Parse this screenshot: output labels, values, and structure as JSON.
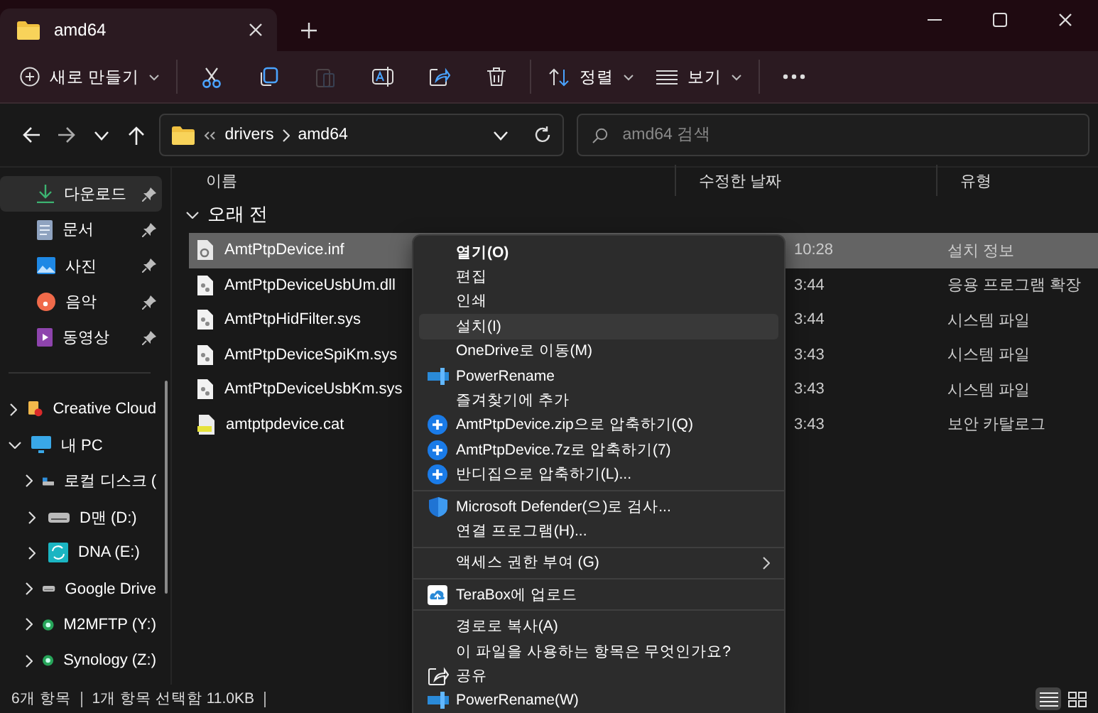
{
  "window": {
    "tab_title": "amd64"
  },
  "toolbar": {
    "items": [
      {
        "kind": "new",
        "label": "새로 만들기",
        "disabled": false
      },
      {
        "kind": "cut",
        "disabled": false
      },
      {
        "kind": "copy",
        "disabled": false
      },
      {
        "kind": "paste",
        "disabled": true
      },
      {
        "kind": "rename",
        "disabled": false
      },
      {
        "kind": "share",
        "disabled": false
      },
      {
        "kind": "delete",
        "disabled": false
      },
      {
        "kind": "sort",
        "label": "정렬",
        "disabled": false
      },
      {
        "kind": "view",
        "label": "보기",
        "disabled": false
      },
      {
        "kind": "more",
        "disabled": false
      }
    ]
  },
  "address": {
    "path": [
      "drivers",
      "amd64"
    ],
    "search_placeholder": "amd64 검색"
  },
  "sidebar": {
    "quick_access": [
      {
        "label": "다운로드",
        "kind": "download",
        "selected": true
      },
      {
        "label": "문서",
        "kind": "document",
        "selected": false
      },
      {
        "label": "사진",
        "kind": "picture",
        "selected": false
      },
      {
        "label": "음악",
        "kind": "music",
        "selected": false
      },
      {
        "label": "동영상",
        "kind": "video",
        "selected": false
      }
    ],
    "tree": [
      {
        "label": "Creative Cloud",
        "kind": "cloud",
        "expanded": false,
        "selected": false
      },
      {
        "label": "내 PC",
        "kind": "pc",
        "expanded": true,
        "selected": false,
        "children": [
          {
            "label": "로컬 디스크 (",
            "kind": "system-drive",
            "expanded": false,
            "selected": false
          },
          {
            "label": "D맨 (D:)",
            "kind": "drive",
            "expanded": false,
            "selected": false
          },
          {
            "label": "DNA (E:)",
            "kind": "sync-drive",
            "expanded": false,
            "selected": false
          },
          {
            "label": "Google Drive",
            "kind": "drive",
            "expanded": false,
            "selected": false
          },
          {
            "label": "M2MFTP (Y:)",
            "kind": "network-drive",
            "expanded": false,
            "selected": false
          },
          {
            "label": "Synology (Z:)",
            "kind": "network-drive",
            "expanded": false,
            "selected": false
          }
        ]
      }
    ]
  },
  "file_list": {
    "columns": [
      "이름",
      "수정한 날짜",
      "유형"
    ],
    "group": "오래 전",
    "rows": [
      {
        "name": "AmtPtpDevice.inf",
        "modified": "10:28",
        "type": "설치 정보",
        "kind": "setup",
        "selected": true
      },
      {
        "name": "AmtPtpDeviceUsbUm.dll",
        "modified": "3:44",
        "type": "응용 프로그램 확장",
        "kind": "system",
        "selected": false
      },
      {
        "name": "AmtPtpHidFilter.sys",
        "modified": "3:44",
        "type": "시스템 파일",
        "kind": "system",
        "selected": false
      },
      {
        "name": "AmtPtpDeviceSpiKm.sys",
        "modified": "3:43",
        "type": "시스템 파일",
        "kind": "system",
        "selected": false
      },
      {
        "name": "AmtPtpDeviceUsbKm.sys",
        "modified": "3:43",
        "type": "시스템 파일",
        "kind": "system",
        "selected": false
      },
      {
        "name": "amtptpdevice.cat",
        "modified": "3:43",
        "type": "보안 카탈로그",
        "kind": "catalog",
        "selected": false
      }
    ]
  },
  "context_menu": {
    "items": [
      {
        "kind": "item",
        "label": "열기(O)",
        "default": true,
        "selected": false,
        "submenu": false
      },
      {
        "kind": "item",
        "label": "편집",
        "default": false,
        "selected": false,
        "submenu": false
      },
      {
        "kind": "item",
        "label": "인쇄",
        "default": false,
        "selected": false,
        "submenu": false
      },
      {
        "kind": "item",
        "label": "설치(I)",
        "default": false,
        "selected": true,
        "submenu": false
      },
      {
        "kind": "item",
        "label": "OneDrive로 이동(M)",
        "default": false,
        "selected": false,
        "submenu": false
      },
      {
        "kind": "rename",
        "label": "PowerRename",
        "default": false,
        "selected": false,
        "submenu": false
      },
      {
        "kind": "item",
        "label": "즐겨찾기에 추가",
        "default": false,
        "selected": false,
        "submenu": false
      },
      {
        "kind": "compress",
        "label": "AmtPtpDevice.zip으로 압축하기(Q)",
        "default": false,
        "selected": false,
        "submenu": false
      },
      {
        "kind": "compress",
        "label": "AmtPtpDevice.7z로 압축하기(7)",
        "default": false,
        "selected": false,
        "submenu": false
      },
      {
        "kind": "compress",
        "label": "반디집으로 압축하기(L)...",
        "default": false,
        "selected": false,
        "submenu": false
      },
      {
        "kind": "separator"
      },
      {
        "kind": "defender",
        "label": "Microsoft Defender(으)로 검사...",
        "default": false,
        "selected": false,
        "submenu": false
      },
      {
        "kind": "item",
        "label": "연결 프로그램(H)...",
        "default": false,
        "selected": false,
        "submenu": false
      },
      {
        "kind": "separator"
      },
      {
        "kind": "item",
        "label": "액세스 권한 부여 (G)",
        "default": false,
        "selected": false,
        "submenu": true
      },
      {
        "kind": "separator"
      },
      {
        "kind": "upload",
        "label": "TeraBox에 업로드",
        "default": false,
        "selected": false,
        "submenu": false
      },
      {
        "kind": "separator"
      },
      {
        "kind": "item",
        "label": "경로로 복사(A)",
        "default": false,
        "selected": false,
        "submenu": false
      },
      {
        "kind": "item",
        "label": "이 파일을 사용하는 항목은 무엇인가요?",
        "default": false,
        "selected": false,
        "submenu": false
      },
      {
        "kind": "share",
        "label": "공유",
        "default": false,
        "selected": false,
        "submenu": false
      },
      {
        "kind": "rename",
        "label": "PowerRename(W)",
        "default": false,
        "selected": false,
        "submenu": false
      }
    ]
  },
  "status_bar": {
    "item_count": "6개 항목",
    "selection": "1개 항목 선택함 11.0KB",
    "views": [
      {
        "kind": "details",
        "selected": true
      },
      {
        "kind": "tiles",
        "selected": false
      }
    ]
  }
}
